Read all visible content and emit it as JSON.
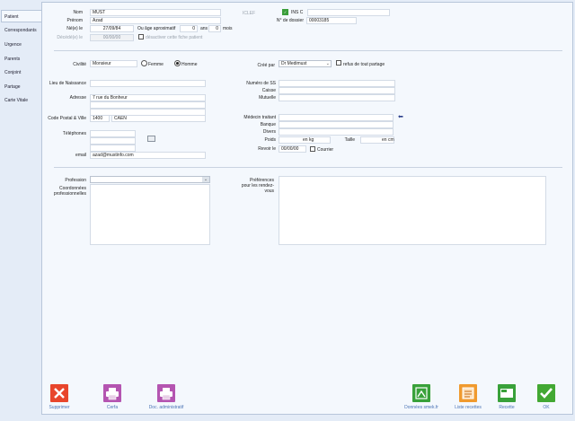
{
  "sidebar": {
    "items": [
      {
        "label": "Patient"
      },
      {
        "label": "Correspondants"
      },
      {
        "label": "Urgence"
      },
      {
        "label": "Parents"
      },
      {
        "label": "Conjoint"
      },
      {
        "label": "Partage"
      },
      {
        "label": "Carte Vitale"
      }
    ]
  },
  "identity": {
    "nom_label": "Nom",
    "nom_value": "MUST",
    "prenom_label": "Prénom",
    "prenom_value": "Azad",
    "ne_label": "Né(e) le",
    "ne_value": "27/09/84",
    "age_label": "Ou âge aproximatif",
    "age_years": "0",
    "age_years_unit": "ans",
    "age_months": "0",
    "age_months_unit": "mois",
    "decede_label": "Décédé(e) le",
    "decede_value": "00/00/00",
    "desactiver_label": "désactiver cette fiche patient",
    "iclef_label": "ICLEF",
    "ins_label": "INS C",
    "dossier_label": "N° de dossier",
    "dossier_value": "00003185"
  },
  "civil": {
    "civilite_label": "Civilité",
    "civilite_value": "Monsieur",
    "femme_label": "Femme",
    "homme_label": "Homme",
    "cree_par_label": "Créé par",
    "cree_par_value": "Dr Medimust",
    "refus_label": "refus de tout partage"
  },
  "address": {
    "lieu_label": "Lieu de Naissance",
    "adresse_label": "Adresse",
    "adresse_value": "7 rue du Bonheur",
    "cp_label": "Code Postal & Ville",
    "cp_value": "1400",
    "ville_value": "CAEN",
    "tel_label": "Téléphones",
    "email_label": "email",
    "email_value": "azad@mustinfo.com"
  },
  "medical": {
    "ss_label": "Numéro de SS",
    "caisse_label": "Caisse",
    "mutuelle_label": "Mutuelle",
    "medecin_label": "Médecin traitant",
    "banque_label": "Banque",
    "divers_label": "Divers",
    "poids_label": "Poids",
    "poids_unit": "en kg",
    "taille_label": "Taille",
    "taille_unit": "en cm",
    "revoir_label": "Revoir le",
    "revoir_value": "00/00/00",
    "courrier_label": "Courrier"
  },
  "profession": {
    "profession_label": "Profession",
    "coord_label_1": "Coordonnées",
    "coord_label_2": "professionnelles",
    "pref_label_1": "Préférences",
    "pref_label_2": "pour les rendez-",
    "pref_label_3": "vous"
  },
  "footer": {
    "supprimer": "Supprimer",
    "cerfa": "Cerfa",
    "doc_admin": "Doc. administratif",
    "donnees": "Données smek.fr",
    "liste_recettes": "Liste recettes",
    "recette": "Recette",
    "ok": "OK"
  },
  "colors": {
    "delete": "#e8462c",
    "print": "#b455b1",
    "green": "#39a13a",
    "orange": "#f09a2e",
    "ok": "#42a833",
    "accent_text": "#4a73b5"
  }
}
